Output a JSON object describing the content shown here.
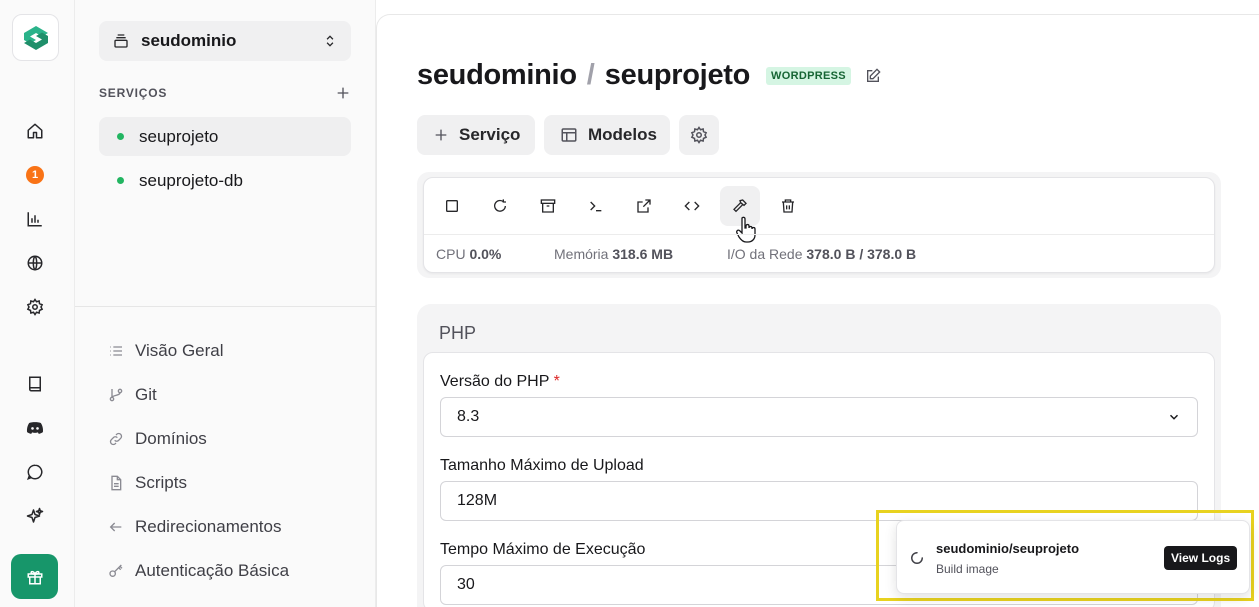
{
  "rail": {
    "notifications_count": "1",
    "icons": [
      "home-icon",
      "bell-badge",
      "chart-icon",
      "globe-icon",
      "gear-icon",
      "book-icon",
      "discord-icon",
      "chat-icon",
      "sparkles-icon",
      "gift-icon"
    ],
    "accent_color": "#17966a"
  },
  "sidebar": {
    "domain_select": "seudominio",
    "services_title": "SERVIÇOS",
    "services": [
      {
        "name": "seuprojeto",
        "status_color": "#22b561",
        "active": true
      },
      {
        "name": "seuprojeto-db",
        "status_color": "#22b561",
        "active": false
      }
    ],
    "nav": [
      {
        "label": "Visão Geral",
        "icon": "list-icon"
      },
      {
        "label": "Git",
        "icon": "git-branch-icon"
      },
      {
        "label": "Domínios",
        "icon": "link-icon"
      },
      {
        "label": "Scripts",
        "icon": "file-icon"
      },
      {
        "label": "Redirecionamentos",
        "icon": "arrow-left-icon"
      },
      {
        "label": "Autenticação Básica",
        "icon": "key-icon"
      }
    ]
  },
  "header": {
    "domain": "seudominio",
    "separator": "/",
    "project": "seuprojeto",
    "tag": "WORDPRESS"
  },
  "actions": {
    "service_label": "Serviço",
    "models_label": "Modelos"
  },
  "toolbar": {
    "icons": [
      "stop-icon",
      "restart-icon",
      "archive-icon",
      "terminal-icon",
      "external-link-icon",
      "code-icon",
      "hammer-icon",
      "trash-icon"
    ],
    "stats": {
      "cpu_label": "CPU",
      "cpu_value": "0.0%",
      "memory_label": "Memória",
      "memory_value": "318.6 MB",
      "network_label": "I/O da Rede",
      "network_value": "378.0 B / 378.0 B"
    }
  },
  "php": {
    "title": "PHP",
    "version_label": "Versão do PHP",
    "required_mark": "*",
    "version_value": "8.3",
    "upload_label": "Tamanho Máximo de Upload",
    "upload_value": "128M",
    "exec_label": "Tempo Máximo de Execução",
    "exec_value": "30"
  },
  "toast": {
    "title": "seudominio/seuprojeto",
    "subtitle": "Build image",
    "button": "View Logs"
  }
}
